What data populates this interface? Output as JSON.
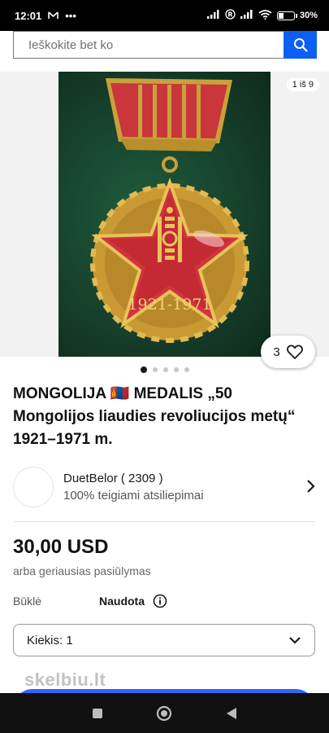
{
  "status": {
    "time": "12:01",
    "battery": "30"
  },
  "search": {
    "placeholder": "Ieškokite bet ko"
  },
  "gallery": {
    "counter": "1 iš 9",
    "likes": "3",
    "pages": 5,
    "active_page": 1
  },
  "medal": {
    "years": "1921-1971"
  },
  "listing": {
    "title": "MONGOLIJA 🇲🇳 MEDALIS „50 Mongolijos liaudies revoliucijos metų“ 1921–1971 m.",
    "price": "30,00 USD",
    "price_sub": "arba geriausias pasiūlymas",
    "condition_label": "Būklė",
    "condition_value": "Naudota",
    "quantity": "Kiekis: 1"
  },
  "seller": {
    "name": "DuetBelor ( 2309 )",
    "feedback": "100% teigiami atsiliepimai"
  },
  "watermark": "skelbiu.lt",
  "colors": {
    "accent": "#0c5ff5",
    "buy_button": "#3665f3"
  }
}
